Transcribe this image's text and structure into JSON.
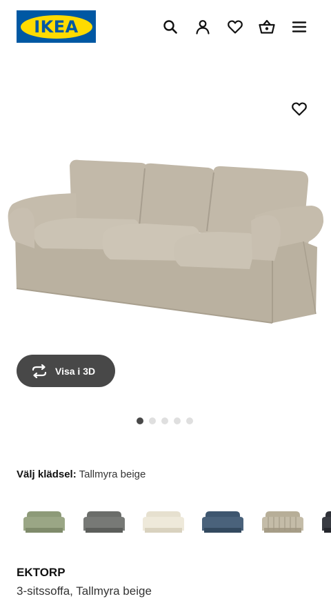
{
  "header": {
    "logo_text": "IKEA",
    "icons": [
      "search-icon",
      "account-icon",
      "heart-icon",
      "cart-icon",
      "menu-icon"
    ]
  },
  "gallery": {
    "favorite_icon": "heart-icon",
    "view_3d_label": "Visa i 3D",
    "page_count": 5,
    "active_page": 1
  },
  "fabric": {
    "label": "Välj klädsel:",
    "value": "Tallmyra beige",
    "swatches": [
      {
        "name": "green",
        "color": "#8d9a78"
      },
      {
        "name": "dark-grey",
        "color": "#6b6d6a"
      },
      {
        "name": "white",
        "color": "#e9e3d3"
      },
      {
        "name": "blue",
        "color": "#3e566f"
      },
      {
        "name": "striped",
        "color": "#b7ae98"
      },
      {
        "name": "black",
        "color": "#2e3138"
      }
    ]
  },
  "product": {
    "name": "EKTORP",
    "description": "3-sitssoffa, Tallmyra beige"
  },
  "colors": {
    "ikea_blue": "#0058a3",
    "ikea_yellow": "#ffdb00",
    "sofa_beige": "#bfb6a6",
    "button_dark": "#484848"
  }
}
